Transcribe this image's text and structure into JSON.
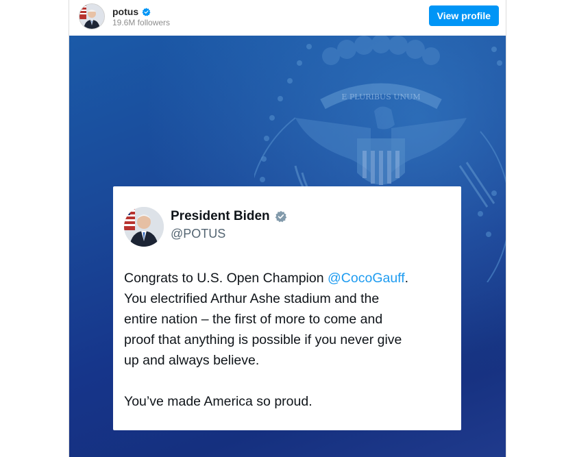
{
  "header": {
    "username": "potus",
    "followers": "19.6M followers",
    "view_profile_label": "View profile",
    "verified_icon": "verified-badge-icon",
    "badge_color": "#0095f6"
  },
  "post": {
    "background_colors": [
      "#1b5aa8",
      "#15307f"
    ],
    "seal_motto": "E PLURIBUS UNUM",
    "tweet": {
      "display_name": "President Biden",
      "handle": "@POTUS",
      "line1_before": "Congrats to U.S. Open Champion ",
      "mention": "@CocoGauff",
      "line1_after": ".",
      "line2": "You electrified Arthur Ashe stadium and the",
      "line3": "entire nation – the first of more to come and",
      "line4": "proof that anything is possible if you never give",
      "line5": "up and always believe.",
      "line6": "You’ve made America so proud.",
      "mention_color": "#1d9bf0"
    }
  }
}
